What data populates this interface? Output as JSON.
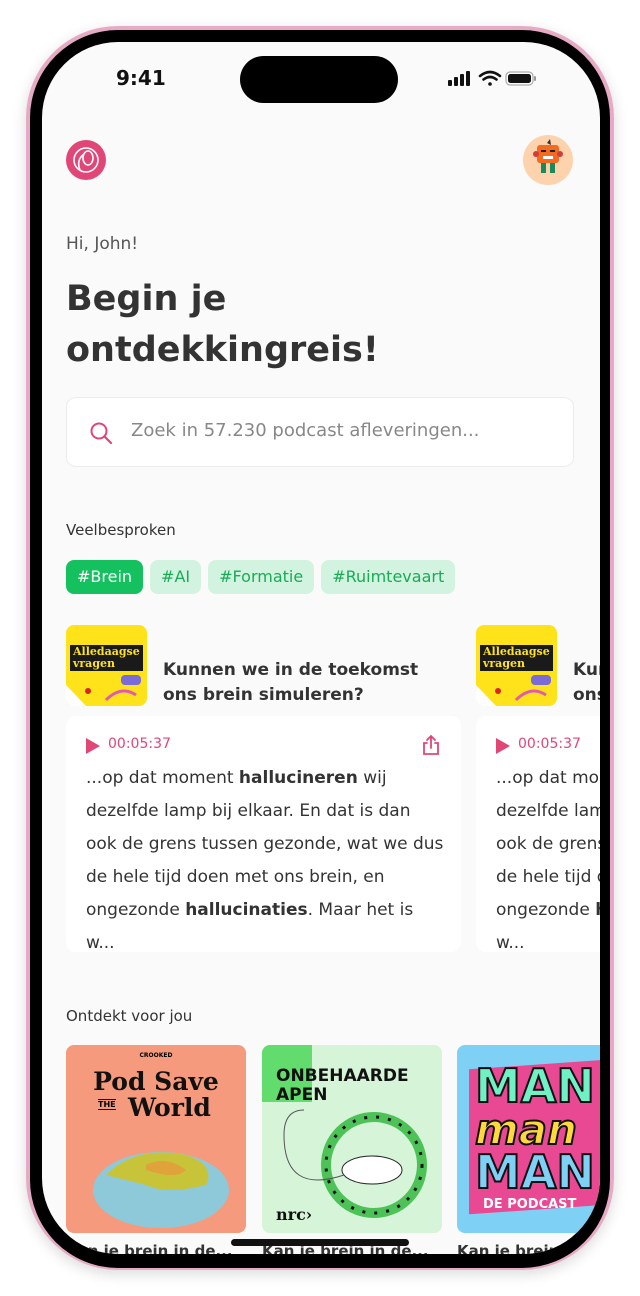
{
  "status": {
    "time": "9:41"
  },
  "header": {
    "logo": "pocket-logo",
    "avatar": "monster-avatar"
  },
  "greeting": "Hi, John!",
  "title_line1": "Begin je",
  "title_line2": "ontdekkingreis!",
  "search": {
    "placeholder": "Zoek in 57.230 podcast afleveringen...",
    "icon": "search-icon"
  },
  "trending": {
    "label": "Veelbesproken",
    "chips": [
      "#Brein",
      "#AI",
      "#Formatie",
      "#Ruimtevaart"
    ],
    "active": "#Brein"
  },
  "episodes": [
    {
      "podcast": "Alledaagse vragen",
      "title": "Kunnen we in de toekomst ons brein simuleren?",
      "timestamp": "00:05:37",
      "snippet": [
        {
          "t": "...op dat moment "
        },
        {
          "t": "hallucineren",
          "b": true
        },
        {
          "t": " wij dezelfde lamp bij elkaar. En dat is dan ook de grens tussen gezonde, wat we dus de hele tijd doen met ons brein, en ongezonde "
        },
        {
          "t": "hallucinaties",
          "b": true
        },
        {
          "t": ". Maar het is w..."
        }
      ]
    },
    {
      "podcast": "Alledaagse vragen",
      "title": "Kunnen we in de toekomst ons brein simuleren?",
      "timestamp": "00:05:37",
      "snippet": [
        {
          "t": "...op dat moment "
        },
        {
          "t": "hallucineren",
          "b": true
        },
        {
          "t": " wij dezelfde lamp bij elkaar. En dat is dan ook de grens tussen gezonde, wat we dus de hele tijd doen met ons brein, en ongezonde "
        },
        {
          "t": "hallucinaties",
          "b": true
        },
        {
          "t": ". Maar het is w..."
        }
      ]
    }
  ],
  "discover": {
    "label": "Ontdekt voor jou",
    "items": [
      {
        "art": {
          "top": "CROOKED",
          "l1": "Pod Save",
          "the": "THE",
          "l2": "World"
        },
        "caption": "Kan je brein in de..."
      },
      {
        "art": {
          "l1": "ONBEHAARDE",
          "l2": "APEN",
          "brand": "nrc›"
        },
        "caption": "Kan je brein in de..."
      },
      {
        "art": {
          "l1": "MAN",
          "l2": "man",
          "l3": "MAN",
          "sub": "DE PODCAST"
        },
        "caption": "Kan je brein in de..."
      }
    ]
  },
  "colors": {
    "accent": "#e04776",
    "green": "#14c15e",
    "chip_bg": "#d2f3df"
  }
}
